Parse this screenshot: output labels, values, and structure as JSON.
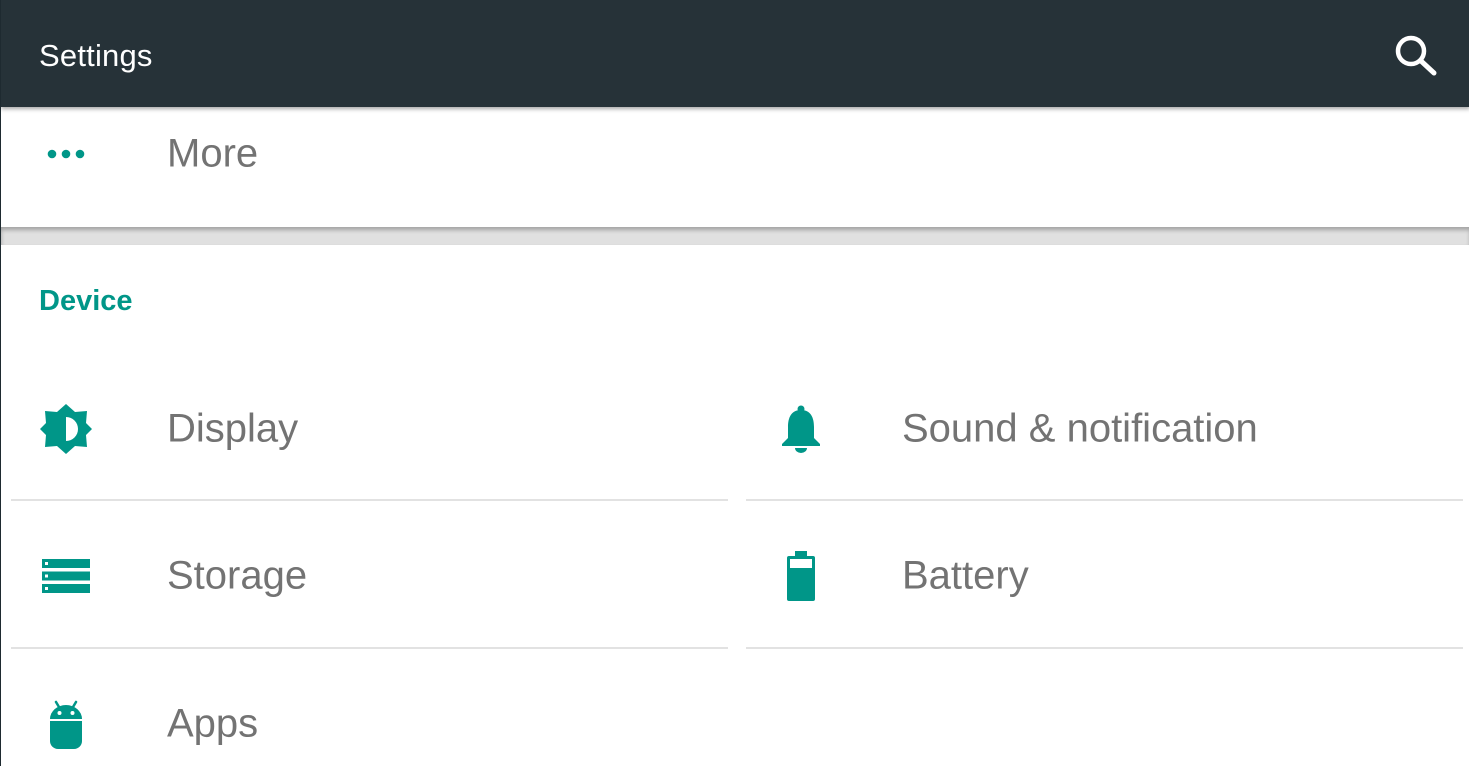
{
  "toolbar": {
    "title": "Settings",
    "search_icon": "search-icon"
  },
  "top_card": {
    "more": {
      "label": "More",
      "icon": "more-horiz-icon"
    }
  },
  "device_section": {
    "header": "Device",
    "items": [
      {
        "label": "Display",
        "icon": "brightness-icon"
      },
      {
        "label": "Sound & notification",
        "icon": "bell-icon"
      },
      {
        "label": "Storage",
        "icon": "storage-icon"
      },
      {
        "label": "Battery",
        "icon": "battery-icon"
      },
      {
        "label": "Apps",
        "icon": "android-icon"
      }
    ]
  },
  "colors": {
    "toolbar_bg": "#263238",
    "accent": "#009688",
    "label_text": "#737373",
    "divider": "#e2e2e2"
  }
}
